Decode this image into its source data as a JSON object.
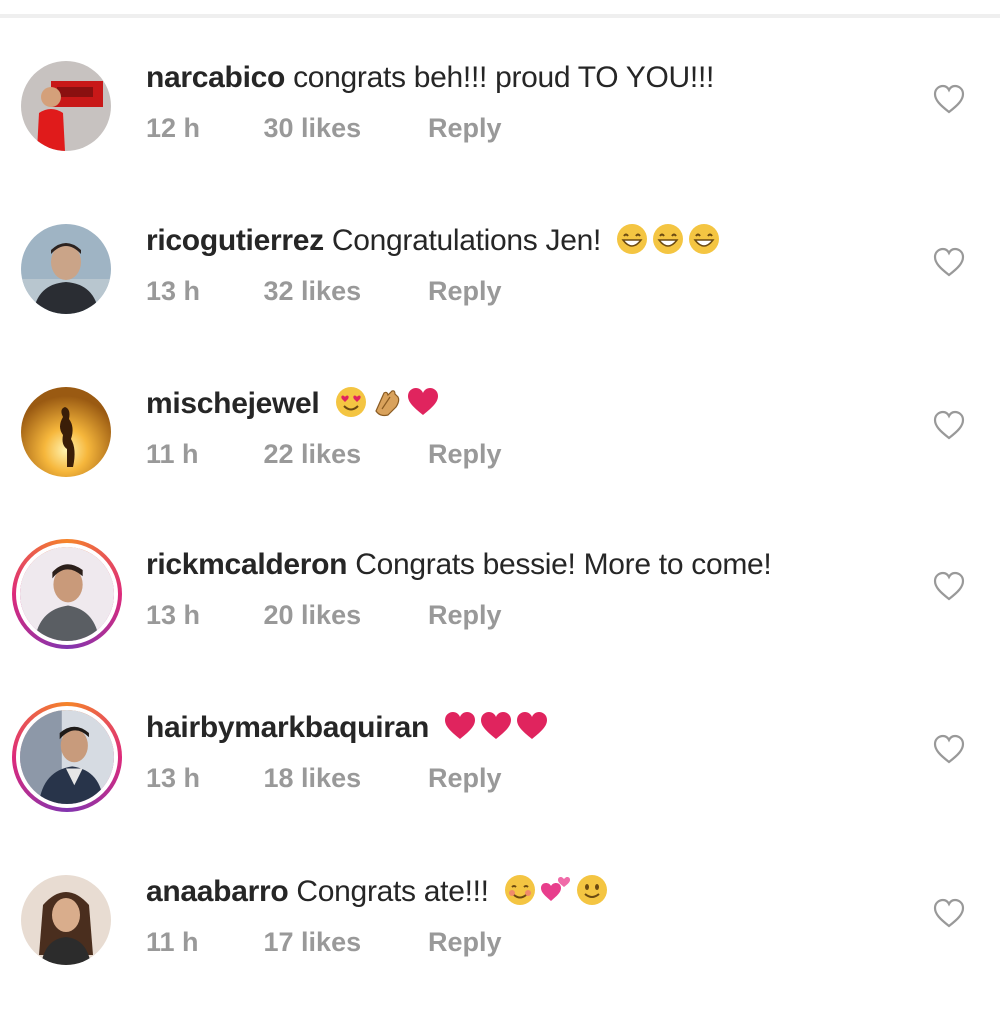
{
  "comments": [
    {
      "username": "narcabico",
      "text": "congrats beh!!! proud TO YOU!!!",
      "time": "12 h",
      "likes": "30 likes",
      "reply": "Reply",
      "emojis": []
    },
    {
      "username": "ricogutierrez",
      "text": "Congratulations Jen!",
      "time": "13 h",
      "likes": "32 likes",
      "reply": "Reply",
      "emojis": [
        "grinning-face",
        "grinning-face",
        "grinning-face"
      ]
    },
    {
      "username": "mischejewel",
      "text": "",
      "time": "11 h",
      "likes": "22 likes",
      "reply": "Reply",
      "emojis": [
        "heart-eyes-face",
        "clapping-hands",
        "red-heart"
      ]
    },
    {
      "username": "rickmcalderon",
      "text": "Congrats bessie! More to come!",
      "time": "13 h",
      "likes": "20 likes",
      "reply": "Reply",
      "emojis": []
    },
    {
      "username": "hairbymarkbaquiran",
      "text": "",
      "time": "13 h",
      "likes": "18 likes",
      "reply": "Reply",
      "emojis": [
        "red-heart",
        "red-heart",
        "red-heart"
      ]
    },
    {
      "username": "anaabarro",
      "text": "Congrats ate!!!",
      "time": "11 h",
      "likes": "17 likes",
      "reply": "Reply",
      "emojis": [
        "blushing-face",
        "two-hearts",
        "smiling-face"
      ]
    }
  ],
  "icons": {
    "like": "heart-outline-icon"
  },
  "colors": {
    "text": "#262626",
    "meta": "#999999",
    "heart_emoji": "#e0245e",
    "story_ring": "#dd2a7b"
  }
}
